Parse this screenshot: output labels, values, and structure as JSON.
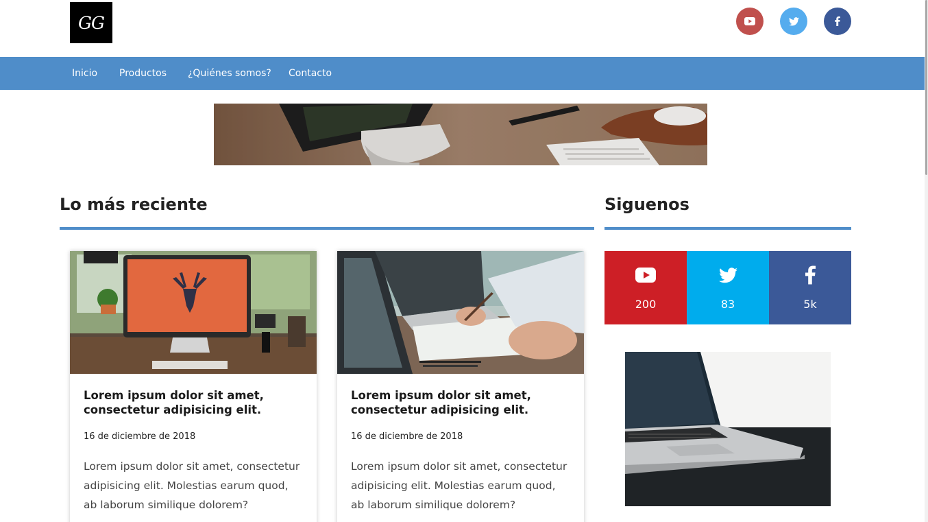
{
  "logo": {
    "text": "GG"
  },
  "header_social": [
    {
      "name": "youtube",
      "icon": "youtube-icon",
      "color": "#c0504d"
    },
    {
      "name": "twitter",
      "icon": "twitter-icon",
      "color": "#55acee"
    },
    {
      "name": "facebook",
      "icon": "facebook-icon",
      "color": "#3b5998"
    }
  ],
  "nav": {
    "items": [
      {
        "label": "Inicio"
      },
      {
        "label": "Productos"
      },
      {
        "label": "¿Quiénes somos?"
      },
      {
        "label": "Contacto"
      }
    ],
    "color": "#4f8dc9"
  },
  "main": {
    "section_title": "Lo más reciente",
    "posts": [
      {
        "image": "desk-computer-photo",
        "title": "Lorem ipsum dolor sit amet, consectetur adipisicing elit.",
        "date": "16 de diciembre de 2018",
        "excerpt": "Lorem ipsum dolor sit amet, consectetur adipisicing elit. Molestias earum quod, ab laborum similique dolorem?"
      },
      {
        "image": "laptop-paperwork-photo",
        "title": "Lorem ipsum dolor sit amet, consectetur adipisicing elit.",
        "date": "16 de diciembre de 2018",
        "excerpt": "Lorem ipsum dolor sit amet, consectetur adipisicing elit. Molestias earum quod, ab laborum similique dolorem?"
      }
    ]
  },
  "sidebar": {
    "section_title": "Siguenos",
    "follow": [
      {
        "network": "youtube",
        "icon": "youtube-icon",
        "count": "200",
        "color": "#cd1f26"
      },
      {
        "network": "twitter",
        "icon": "twitter-icon",
        "count": "83",
        "color": "#00aced"
      },
      {
        "network": "facebook",
        "icon": "facebook-icon",
        "count": "5k",
        "color": "#3b5998"
      }
    ],
    "image": "laptop-side-photo"
  }
}
